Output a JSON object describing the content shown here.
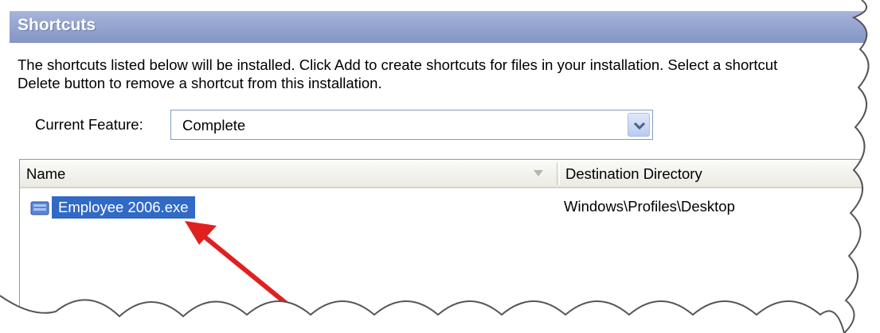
{
  "header": {
    "title": "Shortcuts"
  },
  "description": {
    "line1": "The shortcuts listed below will be installed. Click Add to create shortcuts for files in your installation. Select a shortcut",
    "line2": "Delete button to remove a shortcut from this installation."
  },
  "feature": {
    "label": "Current Feature:",
    "value": "Complete"
  },
  "list": {
    "columns": {
      "name": "Name",
      "destination": "Destination Directory"
    },
    "rows": [
      {
        "name": "Employee 2006.exe",
        "destination": "Windows\\Profiles\\Desktop",
        "selected": true
      }
    ]
  },
  "colors": {
    "header": "#8f9fcd",
    "selection": "#316ac5",
    "annotation_arrow": "#e02020"
  },
  "icons": {
    "shortcut": "shortcut-icon",
    "dropdown": "chevron-down-icon",
    "sort": "sort-arrow-icon"
  }
}
